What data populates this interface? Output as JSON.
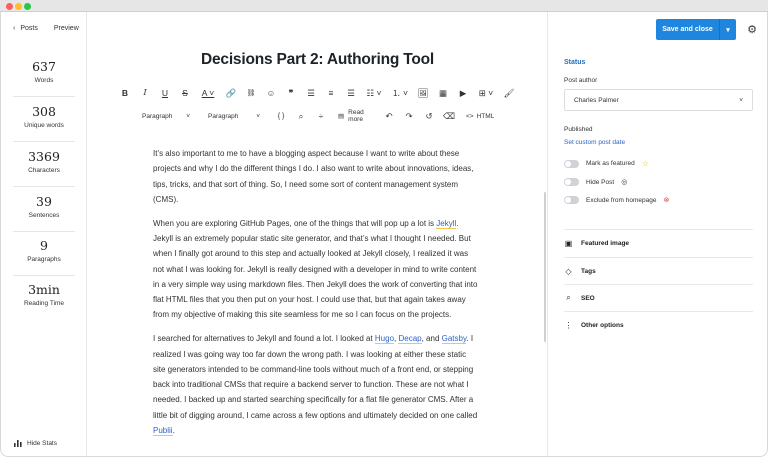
{
  "left": {
    "back_label": "Posts",
    "preview_label": "Preview",
    "stats": [
      {
        "value": "637",
        "label": "Words"
      },
      {
        "value": "308",
        "label": "Unique words"
      },
      {
        "value": "3369",
        "label": "Characters"
      },
      {
        "value": "39",
        "label": "Sentences"
      },
      {
        "value": "9",
        "label": "Paragraphs"
      },
      {
        "value": "3min",
        "label": "Reading Time"
      }
    ],
    "hide_stats_label": "Hide Stats"
  },
  "editor": {
    "title": "Decisions Part 2: Authoring Tool",
    "toolbar": {
      "format_select_1": "Paragraph",
      "format_select_2": "Paragraph",
      "read_more_label": "Read more",
      "html_label": "HTML"
    },
    "paragraphs": [
      {
        "text": "It’s also important to me to have a blogging aspect because I want to write about these projects and why I do the different things I do. I also want to write about innovations, ideas, tips, tricks, and that sort of thing. So, I need some sort of content management system (CMS)."
      },
      {
        "pre": "When you are exploring GitHub Pages, one of the things that will pop up a lot is ",
        "link1": "Jekyll",
        "post": ". Jekyll is an extremely popular static site generator, and that’s what I thought I needed. But when I finally got around to this step and actually looked at Jekyll closely, I realized it was not what I was looking for. Jekyll is really designed with a developer in mind to write content in a very simple way using markdown files. Then Jekyll does the work of converting that into flat HTML files that you then put on your host. I could use that, but that again takes away from my objective of making this site seamless for me so I can focus on the projects."
      },
      {
        "pre": "I searched for alternatives to Jekyll and found a lot. I looked at ",
        "link1": "Hugo",
        "sep1": ", ",
        "link2": "Decap",
        "sep2": ", and ",
        "link3": "Gatsby",
        "mid": ". I realized I was going way too far down the wrong path. I was looking at either these static site generators intended to be command-line tools without much of a front end, or stepping back into traditional CMSs that require a backend server to function. These are not what I needed. I backed up and started searching specifically for a flat file generator CMS. After a little bit of digging around, I came across a few options and ultimately decided on one called ",
        "link4": "Publii",
        "end": "."
      }
    ]
  },
  "sidebar": {
    "save_label": "Save and close",
    "status_heading": "Status",
    "post_author_label": "Post author",
    "post_author_value": "Charles Palmer",
    "published_label": "Published",
    "custom_date_link": "Set custom post date",
    "toggles": [
      {
        "label": "Mark as featured",
        "icon": "star-icon",
        "on": false
      },
      {
        "label": "Hide Post",
        "icon": "eye-slash-icon",
        "on": false
      },
      {
        "label": "Exclude from homepage",
        "icon": "circle-x-icon",
        "on": false
      }
    ],
    "sections": [
      {
        "label": "Featured image",
        "icon": "image-icon"
      },
      {
        "label": "Tags",
        "icon": "tag-icon"
      },
      {
        "label": "SEO",
        "icon": "search-icon"
      },
      {
        "label": "Other options",
        "icon": "more-vertical-icon"
      }
    ]
  }
}
